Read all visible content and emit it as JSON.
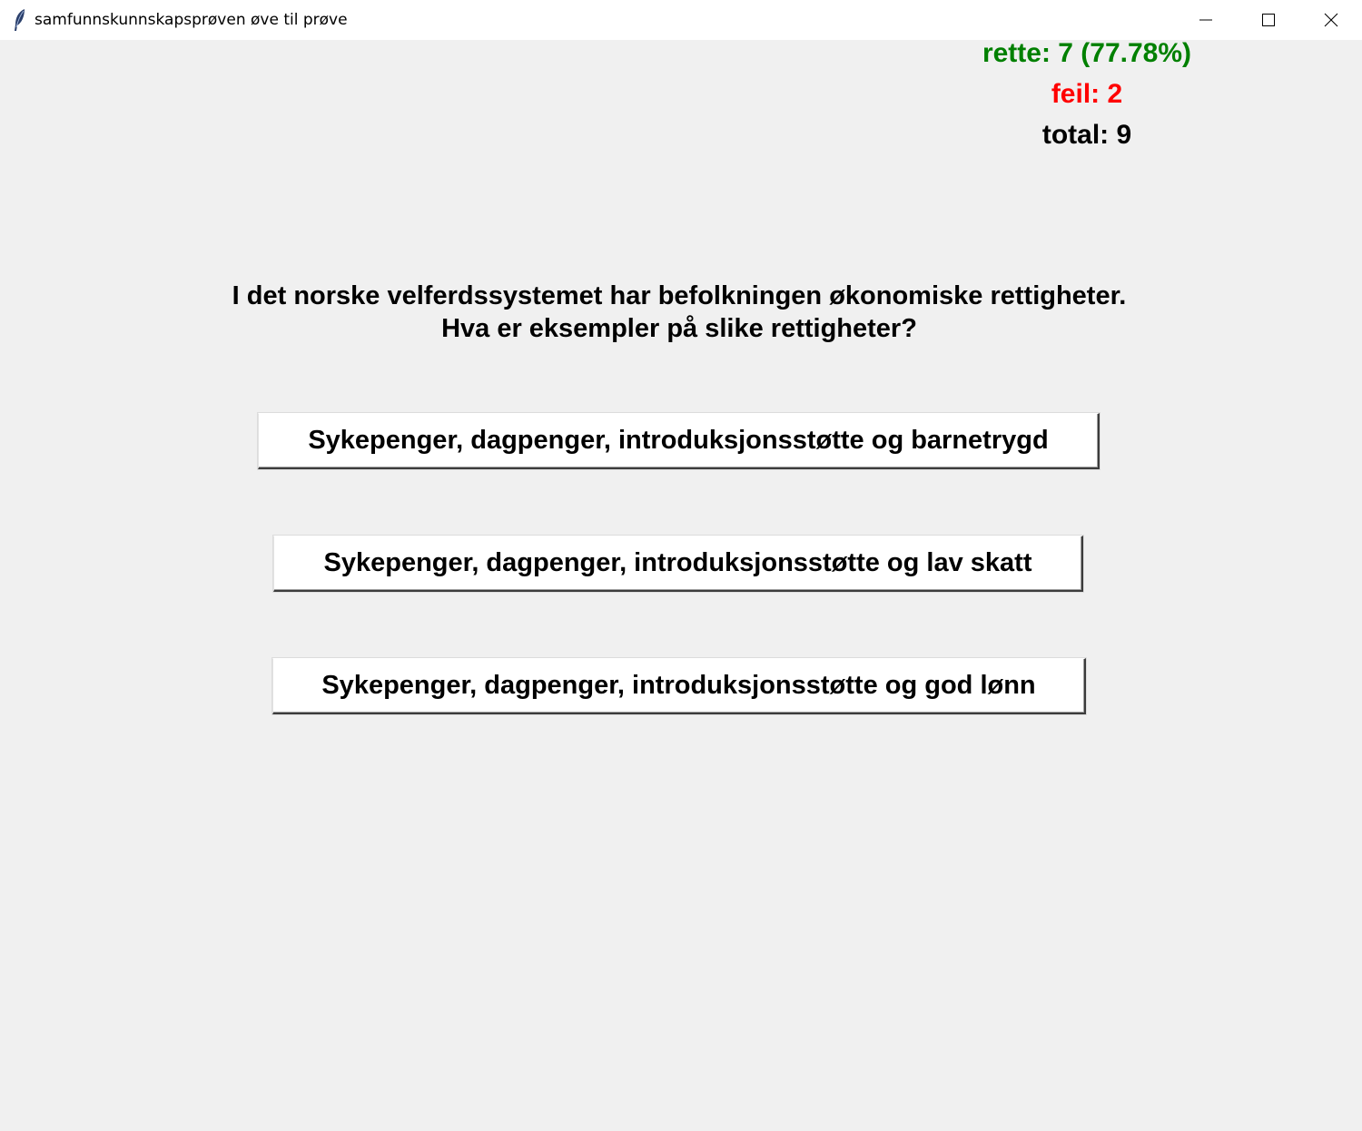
{
  "window": {
    "title": "samfunnskunnskapsprøven øve til prøve",
    "app_icon": "feather-icon",
    "controls": [
      "minimize-icon",
      "maximize-icon",
      "close-icon"
    ]
  },
  "score": {
    "correct": "rette: 7 (77.78%)",
    "wrong": "feil: 2",
    "total": "total: 9",
    "colors": {
      "correct": "#008000",
      "wrong": "#ff0000",
      "total": "#000000"
    }
  },
  "question": {
    "line1": "I det norske velferdssystemet har befolkningen økonomiske rettigheter.",
    "line2": "Hva er eksempler på slike rettigheter?"
  },
  "answers": [
    "Sykepenger, dagpenger, introduksjonsstøtte og barnetrygd",
    "Sykepenger, dagpenger, introduksjonsstøtte og lav skatt",
    "Sykepenger, dagpenger, introduksjonsstøtte og god lønn"
  ]
}
